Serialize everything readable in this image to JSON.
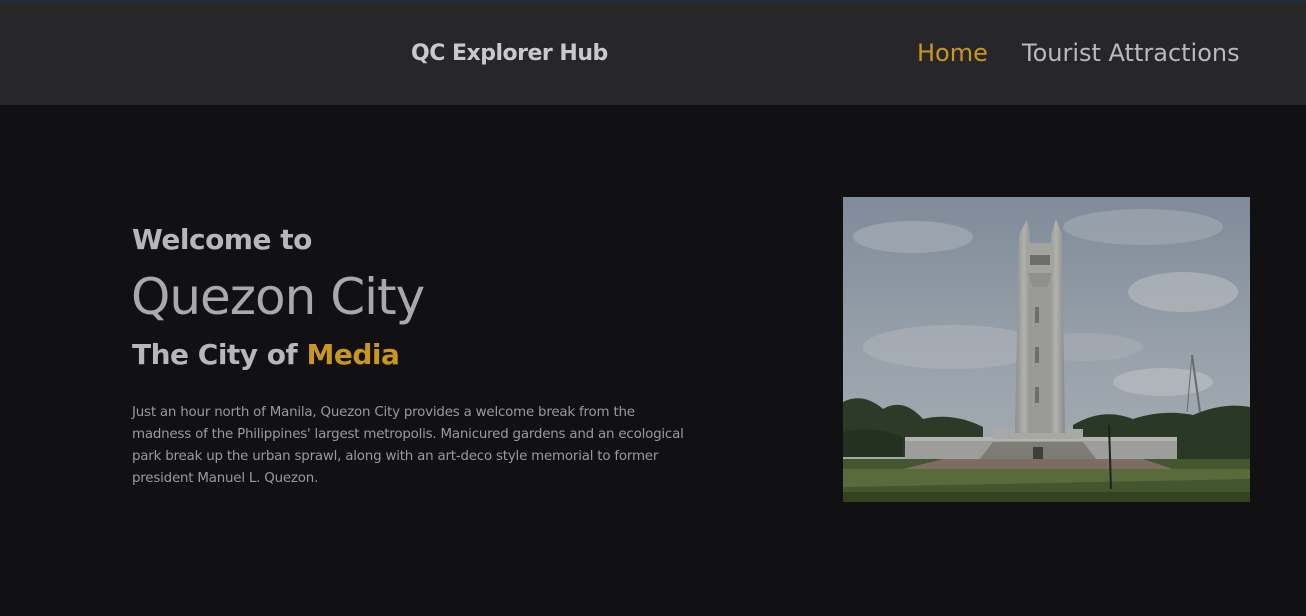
{
  "navbar": {
    "brand": "QC Explorer Hub",
    "links": [
      {
        "label": "Home",
        "active": true
      },
      {
        "label": "Tourist Attractions",
        "active": false
      }
    ]
  },
  "hero": {
    "welcome": "Welcome to",
    "city": "Quezon City",
    "tagline_prefix": "The City of",
    "tagline_highlight": "Media",
    "description": "Just an hour north of Manila, Quezon City provides a welcome break from the madness of the Philippines' largest metropolis. Manicured gardens and an ecological park break up the urban sprawl, along with an art-deco style memorial to former president Manuel L. Quezon."
  },
  "colors": {
    "accent": "#c99620",
    "background": "#111113",
    "navbar": "#272729"
  }
}
